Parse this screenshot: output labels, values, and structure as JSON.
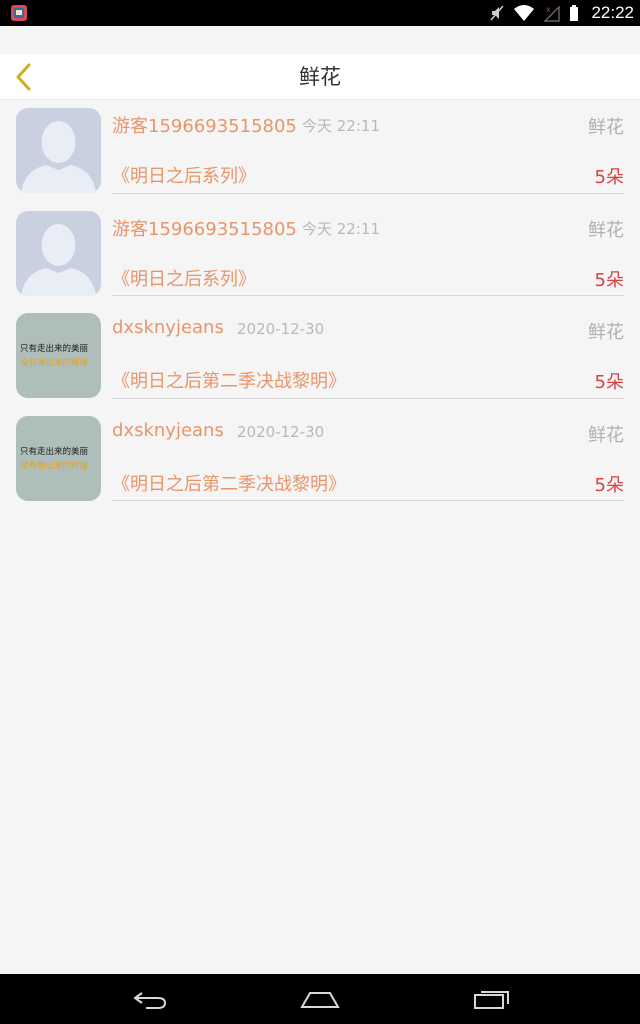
{
  "status_bar": {
    "time": "22:22",
    "icons": [
      "app-icon",
      "mute-icon",
      "wifi-icon",
      "no-signal-icon",
      "battery-icon"
    ]
  },
  "header": {
    "title": "鲜花",
    "back_icon": "chevron-left-icon",
    "accent_color": "#c9b21a"
  },
  "rows": [
    {
      "avatar": "default-avatar",
      "username": "游客1596693515805",
      "time": "今天 22:11",
      "gift_type": "鲜花",
      "book_title": "《明日之后系列》",
      "count": "5朵"
    },
    {
      "avatar": "default-avatar",
      "username": "游客1596693515805",
      "time": "今天 22:11",
      "gift_type": "鲜花",
      "book_title": "《明日之后系列》",
      "count": "5朵"
    },
    {
      "avatar": "image-avatar",
      "avatar_text_line1": "只有走出来的美丽",
      "avatar_text_line2": "没有等出来的辉煌",
      "username": "dxsknyjeans",
      "time": "2020-12-30",
      "gift_type": "鲜花",
      "book_title": "《明日之后第二季决战黎明》",
      "count": "5朵"
    },
    {
      "avatar": "image-avatar",
      "avatar_text_line1": "只有走出来的美丽",
      "avatar_text_line2": "没有等出来的辉煌",
      "username": "dxsknyjeans",
      "time": "2020-12-30",
      "gift_type": "鲜花",
      "book_title": "《明日之后第二季决战黎明》",
      "count": "5朵"
    }
  ],
  "colors": {
    "username": "#e8956a",
    "count": "#d94040",
    "muted": "#b8b8b8"
  },
  "nav_bar": {
    "icons": [
      "back-nav-icon",
      "home-nav-icon",
      "recents-nav-icon"
    ]
  }
}
